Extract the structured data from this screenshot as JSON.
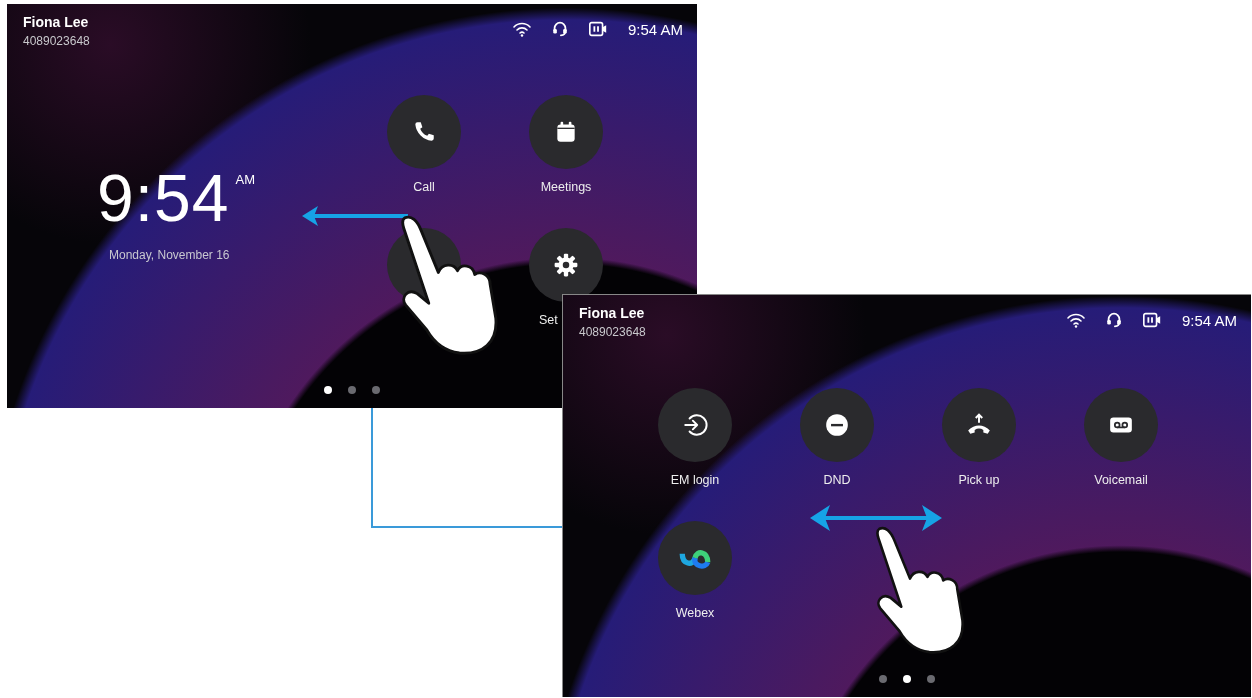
{
  "screens": [
    {
      "kind": "home",
      "user_name": "Fiona Lee",
      "number": "4089023648",
      "status_time": "9:54 AM",
      "clock": {
        "time": "9:54",
        "period": "AM",
        "date": "Monday, November 16"
      },
      "apps": [
        {
          "kind": "phone",
          "label": "Call"
        },
        {
          "kind": "calendar",
          "label": "Meetings"
        },
        {
          "kind": "hidden"
        },
        {
          "kind": "gear",
          "label": "Set",
          "clipped": true
        }
      ],
      "pages": [
        {
          "selected": true
        },
        {
          "selected": false
        },
        {
          "selected": false
        }
      ],
      "gesture": {
        "kind": "swipe-left"
      }
    },
    {
      "kind": "apps",
      "user_name": "Fiona Lee",
      "number": "4089023648",
      "status_time": "9:54 AM",
      "apps": [
        {
          "kind": "login",
          "label": "EM login"
        },
        {
          "kind": "dnd",
          "label": "DND"
        },
        {
          "kind": "pickup",
          "label": "Pick up"
        },
        {
          "kind": "voicemail",
          "label": "Voicemail"
        },
        {
          "kind": "webex",
          "label": "Webex"
        }
      ],
      "pages": [
        {
          "selected": false
        },
        {
          "selected": true
        },
        {
          "selected": false
        }
      ],
      "gesture": {
        "kind": "swipe-both"
      }
    }
  ]
}
